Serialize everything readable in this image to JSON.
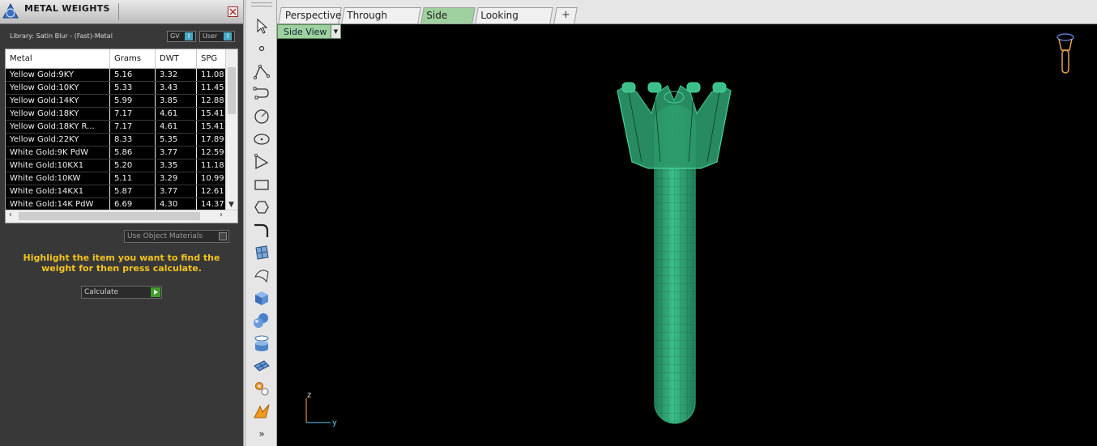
{
  "panel": {
    "title": "METAL WEIGHTS",
    "library": "Library: Satin Blur - (Fast)-Metal",
    "gv_label": "GV",
    "user_label": "User",
    "toggle_glyph": "I",
    "columns": [
      "Metal",
      "Grams",
      "DWT",
      "SPG"
    ],
    "rows": [
      [
        "Yellow Gold:9KY",
        "5.16",
        "3.32",
        "11.08"
      ],
      [
        "Yellow Gold:10KY",
        "5.33",
        "3.43",
        "11.45"
      ],
      [
        "Yellow Gold:14KY",
        "5.99",
        "3.85",
        "12.88"
      ],
      [
        "Yellow Gold:18KY",
        "7.17",
        "4.61",
        "15.41"
      ],
      [
        "Yellow Gold:18KY R...",
        "7.17",
        "4.61",
        "15.41"
      ],
      [
        "Yellow Gold:22KY",
        "8.33",
        "5.35",
        "17.89"
      ],
      [
        "White Gold:9K PdW",
        "5.86",
        "3.77",
        "12.59"
      ],
      [
        "White Gold:10KX1",
        "5.20",
        "3.35",
        "11.18"
      ],
      [
        "White Gold:10KW",
        "5.11",
        "3.29",
        "10.99"
      ],
      [
        "White Gold:14KX1",
        "5.87",
        "3.77",
        "12.61"
      ],
      [
        "White Gold:14K PdW",
        "6.69",
        "4.30",
        "14.37"
      ]
    ],
    "use_object_materials": "Use Object Materials",
    "hint": "Highlight the item you want to find the weight for then press calculate.",
    "calculate": "Calculate"
  },
  "toolbar": {
    "tools": [
      "select-arrow-icon",
      "point-icon",
      "polyline-icon",
      "curve-icon",
      "circle-icon",
      "ellipse-icon",
      "polygon-curve-icon",
      "rectangle-icon",
      "hexagon-icon",
      "fillet-icon",
      "surface-icon",
      "sweep-icon",
      "box-icon",
      "sphere-icon",
      "cylinder-icon",
      "mesh-icon",
      "gears-icon",
      "flag-icon"
    ],
    "more": "»"
  },
  "tabs": [
    {
      "label": "Perspective",
      "active": false
    },
    {
      "label": "Through Finger",
      "active": false
    },
    {
      "label": "Side View",
      "active": true
    },
    {
      "label": "Looking Down",
      "active": false
    }
  ],
  "add_tab": "+",
  "viewport": {
    "view_name": "Side View",
    "axis_z": "z",
    "axis_y": "y",
    "model_color": "#2e9e6e"
  }
}
